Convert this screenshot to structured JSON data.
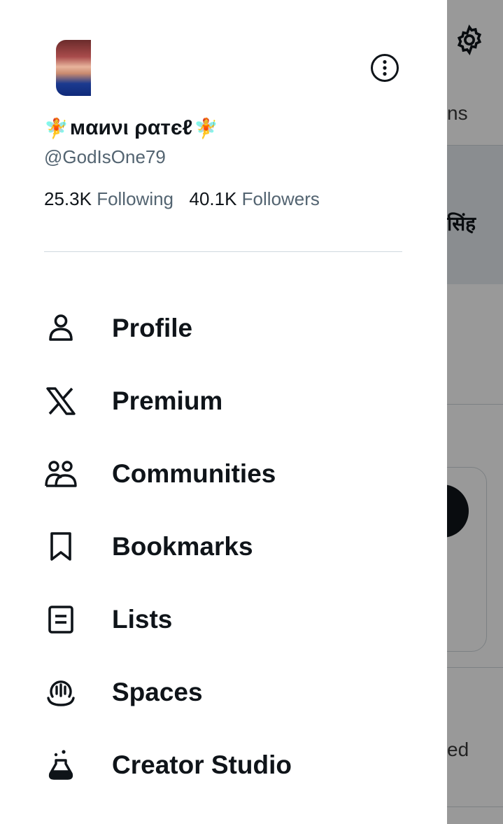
{
  "profile": {
    "display_name": "мαиνι ραтєℓ",
    "name_emoji": "🧚",
    "handle": "@GodIsOne79",
    "following_count": "25.3K",
    "following_label": "Following",
    "followers_count": "40.1K",
    "followers_label": "Followers"
  },
  "menu": [
    {
      "label": "Profile",
      "icon": "person-icon"
    },
    {
      "label": "Premium",
      "icon": "x-logo-icon"
    },
    {
      "label": "Communities",
      "icon": "communities-icon"
    },
    {
      "label": "Bookmarks",
      "icon": "bookmark-icon"
    },
    {
      "label": "Lists",
      "icon": "list-icon"
    },
    {
      "label": "Spaces",
      "icon": "spaces-icon"
    },
    {
      "label": "Creator Studio",
      "icon": "creator-studio-icon"
    }
  ],
  "background": {
    "tab_fragment": "ns",
    "text_fragment_1": "सिंह",
    "text_fragment_2": "ed"
  },
  "colors": {
    "text_primary": "#0f1419",
    "text_secondary": "#536471",
    "divider": "#cfd9de"
  }
}
